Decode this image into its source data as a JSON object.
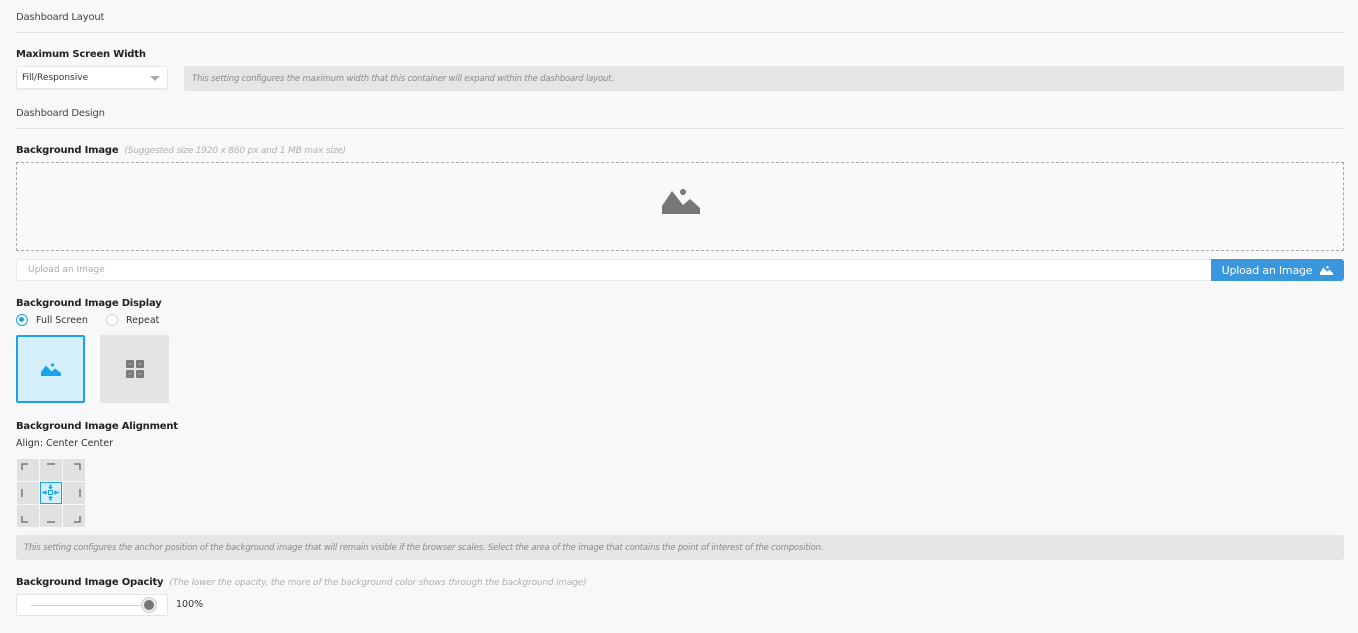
{
  "layout_section": {
    "title": "Dashboard Layout",
    "max_width": {
      "label": "Maximum Screen Width",
      "selected": "Fill/Responsive",
      "info": "This setting configures the maximum width that this container will expand within the dashboard layout."
    }
  },
  "design_section": {
    "title": "Dashboard Design",
    "background_image": {
      "label": "Background Image",
      "hint": "(Suggested size 1920 x 860 px and 1 MB max size)",
      "dropzone_icon": "image-placeholder-icon",
      "upload_placeholder": "Upload an Image",
      "upload_button": "Upload an Image",
      "upload_button_icon": "image-icon"
    },
    "display": {
      "label": "Background Image Display",
      "options": [
        {
          "label": "Full Screen",
          "selected": true,
          "icon": "image-icon"
        },
        {
          "label": "Repeat",
          "selected": false,
          "icon": "grid-tiles-icon"
        }
      ]
    },
    "alignment": {
      "label": "Background Image Alignment",
      "current": "Align: Center Center",
      "selected_cell": "center-center",
      "cells": [
        "top-left",
        "top-center",
        "top-right",
        "center-left",
        "center-center",
        "center-right",
        "bottom-left",
        "bottom-center",
        "bottom-right"
      ],
      "info": "This setting configures the anchor position of the background image that will remain visible if the browser scales. Select the area of the image that contains the point of interest of the composition."
    },
    "opacity": {
      "label": "Background Image Opacity",
      "hint": "(The lower the opacity, the more of the background color shows through the background image)",
      "value_percent": 100,
      "value_label": "100%"
    }
  },
  "colors": {
    "accent": "#1aa3e8",
    "button": "#3a96dd",
    "info_bg": "#e5e5e5",
    "page_bg": "#f8f8f8"
  }
}
